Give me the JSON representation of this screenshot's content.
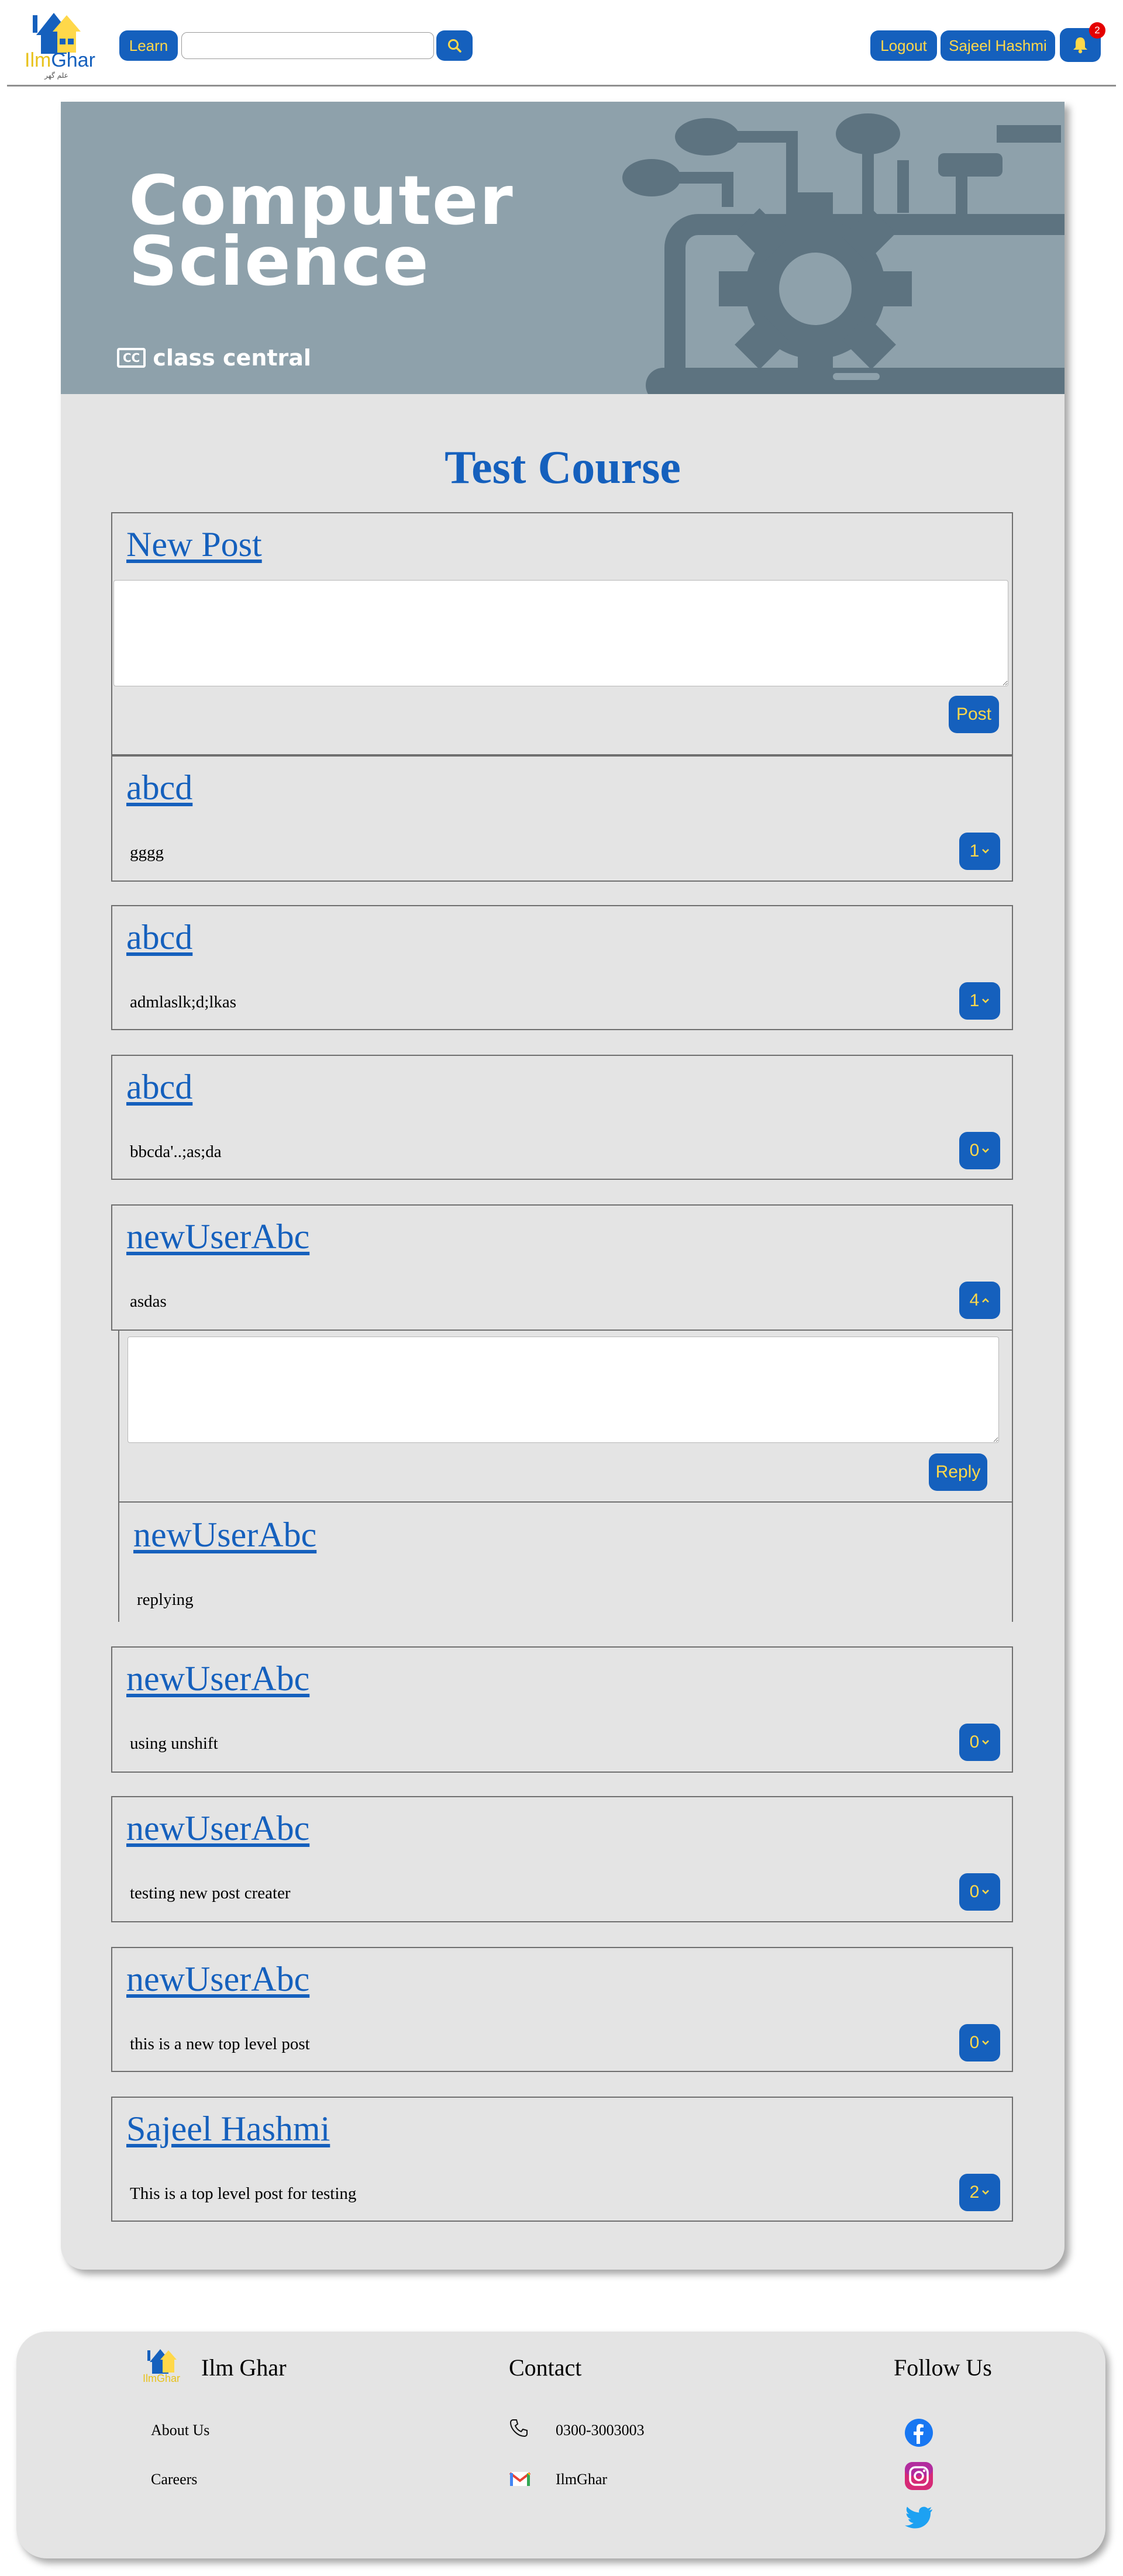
{
  "navbar": {
    "logo_text": "IlmGhar",
    "logo_urdu": "علم گھر",
    "learn_label": "Learn",
    "search_value": "",
    "logout_label": "Logout",
    "user_label": "Sajeel Hashmi",
    "notification_count": "2"
  },
  "banner": {
    "title_line1": "Computer",
    "title_line2": "Science",
    "brand_badge": "CC",
    "brand": "class central"
  },
  "course": {
    "title": "Test Course"
  },
  "new_post": {
    "heading": "New Post",
    "button": "Post",
    "value": ""
  },
  "posts": [
    {
      "author": "abcd",
      "content": "gggg",
      "replies": "1",
      "expanded": false
    },
    {
      "author": "abcd",
      "content": "admlaslk;d;lkas",
      "replies": "1",
      "expanded": false
    },
    {
      "author": "abcd",
      "content": "bbcda'..;as;da",
      "replies": "0",
      "expanded": false
    },
    {
      "author": "newUserAbc",
      "content": "asdas",
      "replies": "4",
      "expanded": true
    },
    {
      "author": "newUserAbc",
      "content": "using unshift",
      "replies": "0",
      "expanded": false
    },
    {
      "author": "newUserAbc",
      "content": "testing new post creater",
      "replies": "0",
      "expanded": false
    },
    {
      "author": "newUserAbc",
      "content": "this is a new top level post",
      "replies": "0",
      "expanded": false
    },
    {
      "author": "Sajeel Hashmi",
      "content": "This is a top level post for testing",
      "replies": "2",
      "expanded": false
    }
  ],
  "reply_box": {
    "button": "Reply",
    "value": ""
  },
  "reply": {
    "author": "newUserAbc",
    "content": "replying"
  },
  "footer": {
    "brand": "Ilm Ghar",
    "logo_text": "IlmGhar",
    "links": [
      "About Us",
      "Careers"
    ],
    "contact_heading": "Contact",
    "phone": "0300-3003003",
    "email": "IlmGhar",
    "follow_heading": "Follow Us",
    "social": [
      "facebook-icon",
      "instagram-icon",
      "twitter-icon"
    ]
  },
  "colors": {
    "primary": "#1560bd",
    "accent": "#ffd84a",
    "card": "#e4e4e4",
    "banner": "#8ea1ab"
  }
}
